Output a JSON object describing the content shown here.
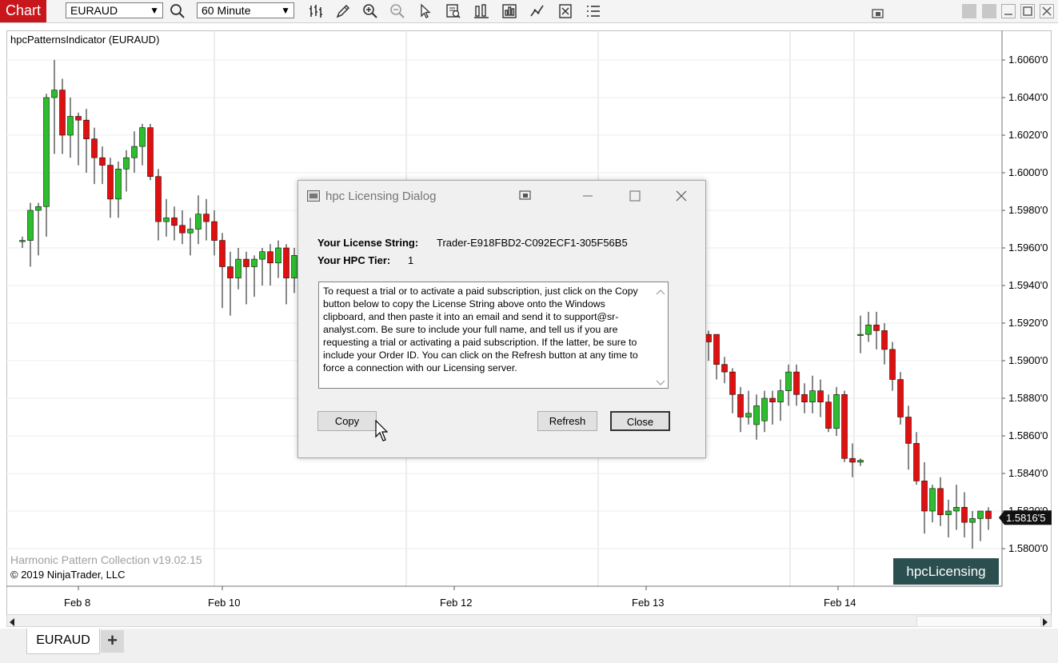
{
  "app": {
    "title": "Chart"
  },
  "toolbar": {
    "instrument": "EURAUD",
    "interval": "60 Minute",
    "icons": [
      "search-icon",
      "bar-type-icon",
      "draw-pencil-icon",
      "zoom-in-icon",
      "zoom-out-icon",
      "pointer-icon",
      "data-box-icon",
      "indicators-icon",
      "strategies-icon",
      "chart-trader-icon",
      "properties-icon",
      "list-icon",
      "restore-icon"
    ]
  },
  "chart": {
    "indicator_label": "hpcPatternsIndicator (EURAUD)",
    "watermark": "Harmonic Pattern Collection v19.02.15",
    "copyright": "© 2019 NinjaTrader, LLC",
    "hpc_button": "hpcLicensing",
    "current_price": "1.5816'5",
    "colors": {
      "up": "#2ebd2e",
      "down": "#e01010",
      "price_tag": "#111111",
      "grid": "#d8d8d8"
    }
  },
  "chart_data": {
    "type": "candlestick",
    "title": "",
    "y_tick_labels": [
      "1.6060'0",
      "1.6040'0",
      "1.6020'0",
      "1.6000'0",
      "1.5980'0",
      "1.5960'0",
      "1.5940'0",
      "1.5920'0",
      "1.5900'0",
      "1.5880'0",
      "1.5860'0",
      "1.5840'0",
      "1.5820'0",
      "1.5800'0"
    ],
    "x_tick_labels": [
      "Feb 8",
      "Feb 10",
      "Feb 12",
      "Feb 13",
      "Feb 14"
    ],
    "ylim": [
      1.5794,
      1.6072
    ],
    "candles": [
      [
        1.5964,
        1.5966,
        1.596,
        1.5964
      ],
      [
        1.5964,
        1.5984,
        1.595,
        1.598
      ],
      [
        1.598,
        1.5984,
        1.5956,
        1.5982
      ],
      [
        1.5982,
        1.6042,
        1.5966,
        1.604
      ],
      [
        1.604,
        1.606,
        1.601,
        1.6044
      ],
      [
        1.6044,
        1.605,
        1.601,
        1.602
      ],
      [
        1.602,
        1.604,
        1.6008,
        1.603
      ],
      [
        1.603,
        1.6032,
        1.6004,
        1.6028
      ],
      [
        1.6028,
        1.6034,
        1.6,
        1.6018
      ],
      [
        1.6018,
        1.6024,
        1.5994,
        1.6008
      ],
      [
        1.6008,
        1.6014,
        1.5994,
        1.6004
      ],
      [
        1.6004,
        1.6008,
        1.5976,
        1.5986
      ],
      [
        1.5986,
        1.6006,
        1.5976,
        1.6002
      ],
      [
        1.6002,
        1.6012,
        1.599,
        1.6008
      ],
      [
        1.6008,
        1.6022,
        1.6,
        1.6014
      ],
      [
        1.6014,
        1.6026,
        1.6004,
        1.6024
      ],
      [
        1.6024,
        1.6026,
        1.5996,
        1.5998
      ],
      [
        1.5998,
        1.6002,
        1.5964,
        1.5974
      ],
      [
        1.5974,
        1.5986,
        1.5966,
        1.5976
      ],
      [
        1.5976,
        1.5982,
        1.5964,
        1.5972
      ],
      [
        1.5972,
        1.598,
        1.5962,
        1.5968
      ],
      [
        1.5968,
        1.5976,
        1.5956,
        1.597
      ],
      [
        1.597,
        1.5988,
        1.5962,
        1.5978
      ],
      [
        1.5978,
        1.5986,
        1.5964,
        1.5974
      ],
      [
        1.5974,
        1.598,
        1.5956,
        1.5964
      ],
      [
        1.5964,
        1.5968,
        1.5928,
        1.595
      ],
      [
        1.595,
        1.5958,
        1.5924,
        1.5944
      ],
      [
        1.5944,
        1.596,
        1.5938,
        1.5954
      ],
      [
        1.5954,
        1.5958,
        1.593,
        1.595
      ],
      [
        1.595,
        1.5956,
        1.5934,
        1.5954
      ],
      [
        1.5954,
        1.596,
        1.594,
        1.5958
      ],
      [
        1.5958,
        1.5962,
        1.594,
        1.5952
      ],
      [
        1.5952,
        1.5964,
        1.5944,
        1.596
      ],
      [
        1.596,
        1.5962,
        1.593,
        1.5944
      ],
      [
        1.5944,
        1.596,
        1.5936,
        1.5956
      ],
      [
        1.5914,
        1.5916,
        1.59,
        1.591
      ],
      [
        1.5914,
        1.5914,
        1.589,
        1.5898
      ],
      [
        1.5898,
        1.5902,
        1.5888,
        1.5894
      ],
      [
        1.5894,
        1.5896,
        1.5872,
        1.5882
      ],
      [
        1.5882,
        1.5886,
        1.5862,
        1.587
      ],
      [
        1.587,
        1.5884,
        1.5866,
        1.5872
      ],
      [
        1.5866,
        1.5882,
        1.5858,
        1.5876
      ],
      [
        1.5868,
        1.5884,
        1.5862,
        1.588
      ],
      [
        1.588,
        1.5884,
        1.5866,
        1.5878
      ],
      [
        1.5878,
        1.589,
        1.5868,
        1.5884
      ],
      [
        1.5884,
        1.5898,
        1.5876,
        1.5894
      ],
      [
        1.5894,
        1.5898,
        1.5876,
        1.5882
      ],
      [
        1.5882,
        1.5888,
        1.5872,
        1.5878
      ],
      [
        1.5878,
        1.5892,
        1.5872,
        1.5884
      ],
      [
        1.5884,
        1.589,
        1.587,
        1.5878
      ],
      [
        1.5878,
        1.5882,
        1.5862,
        1.5864
      ],
      [
        1.5864,
        1.5886,
        1.586,
        1.5882
      ],
      [
        1.5882,
        1.5884,
        1.5846,
        1.5848
      ],
      [
        1.5848,
        1.5856,
        1.5838,
        1.5846
      ],
      [
        1.5846,
        1.5848,
        1.5844,
        1.5847
      ],
      [
        1.5914,
        1.5924,
        1.5904,
        1.5914
      ],
      [
        1.5914,
        1.5926,
        1.591,
        1.5919
      ],
      [
        1.5919,
        1.5926,
        1.5906,
        1.5916
      ],
      [
        1.5916,
        1.592,
        1.5898,
        1.5906
      ],
      [
        1.5906,
        1.591,
        1.5884,
        1.589
      ],
      [
        1.589,
        1.5894,
        1.5866,
        1.587
      ],
      [
        1.587,
        1.5876,
        1.5842,
        1.5856
      ],
      [
        1.5856,
        1.5862,
        1.5834,
        1.5836
      ],
      [
        1.5836,
        1.5846,
        1.5808,
        1.582
      ],
      [
        1.582,
        1.5834,
        1.5814,
        1.5832
      ],
      [
        1.5832,
        1.5838,
        1.5812,
        1.5818
      ],
      [
        1.5818,
        1.5826,
        1.5806,
        1.582
      ],
      [
        1.582,
        1.5834,
        1.581,
        1.5822
      ],
      [
        1.5822,
        1.583,
        1.5806,
        1.5814
      ],
      [
        1.5814,
        1.582,
        1.58,
        1.5816
      ],
      [
        1.5816,
        1.5818,
        1.5804,
        1.582
      ],
      [
        1.582,
        1.5822,
        1.581,
        1.5816
      ]
    ]
  },
  "dialog": {
    "title": "hpc Licensing Dialog",
    "license_label": "Your License String:",
    "license_value": "Trader-E918FBD2-C092ECF1-305F56B5",
    "tier_label": "Your HPC Tier:",
    "tier_value": "1",
    "message": "To request a trial or to activate a paid subscription, just click on the Copy button below to copy the License String above onto the Windows clipboard, and then paste it into an email and send it to support@sr-analyst.com. Be sure to include your full name, and tell us if you are requesting a trial or activating a paid subscription. If the latter, be sure to include your Order ID. You can click on the Refresh button at any time to force a connection with our Licensing server.",
    "buttons": {
      "copy": "Copy",
      "refresh": "Refresh",
      "close": "Close"
    }
  },
  "tabs": [
    {
      "label": "EURAUD"
    }
  ],
  "tab_add": "+"
}
